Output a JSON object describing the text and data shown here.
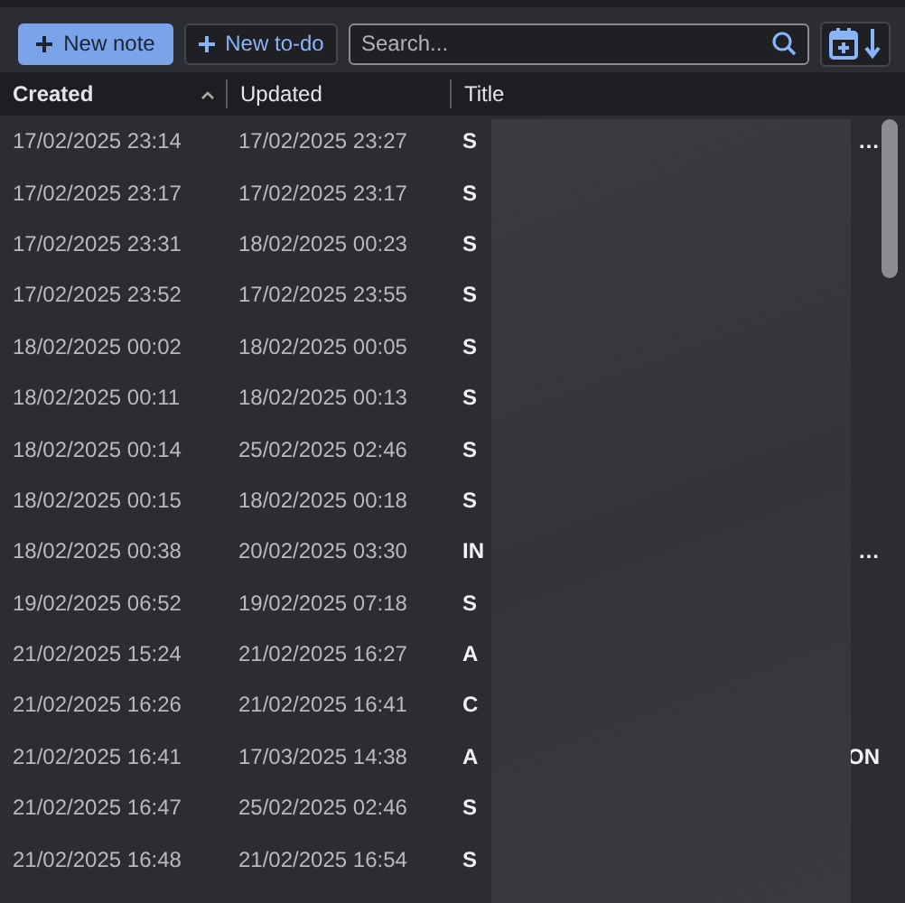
{
  "toolbar": {
    "new_note": "New note",
    "new_todo": "New to-do",
    "search": {
      "placeholder": "Search..."
    }
  },
  "columns": [
    {
      "label": "Created",
      "sorted": true
    },
    {
      "label": "Updated",
      "sorted": false
    },
    {
      "label": "Title",
      "sorted": false
    }
  ],
  "rows": [
    {
      "created": "17/02/2025 23:14",
      "updated": "17/02/2025 23:27",
      "title": "S",
      "title_end": "…"
    },
    {
      "created": "17/02/2025 23:17",
      "updated": "17/02/2025 23:17",
      "title": "S"
    },
    {
      "created": "17/02/2025 23:31",
      "updated": "18/02/2025 00:23",
      "title": "S"
    },
    {
      "created": "17/02/2025 23:52",
      "updated": "17/02/2025 23:55",
      "title": "S"
    },
    {
      "created": "18/02/2025 00:02",
      "updated": "18/02/2025 00:05",
      "title": "S"
    },
    {
      "created": "18/02/2025 00:11",
      "updated": "18/02/2025 00:13",
      "title": "S"
    },
    {
      "created": "18/02/2025 00:14",
      "updated": "25/02/2025 02:46",
      "title": "S"
    },
    {
      "created": "18/02/2025 00:15",
      "updated": "18/02/2025 00:18",
      "title": "S"
    },
    {
      "created": "18/02/2025 00:38",
      "updated": "20/02/2025 03:30",
      "title": "IN",
      "title_end": "…"
    },
    {
      "created": "19/02/2025 06:52",
      "updated": "19/02/2025 07:18",
      "title": "S"
    },
    {
      "created": "21/02/2025 15:24",
      "updated": "21/02/2025 16:27",
      "title": "A"
    },
    {
      "created": "21/02/2025 16:26",
      "updated": "21/02/2025 16:41",
      "title": "C"
    },
    {
      "created": "21/02/2025 16:41",
      "updated": "17/03/2025 14:38",
      "title": "A",
      "title_end": "ON"
    },
    {
      "created": "21/02/2025 16:47",
      "updated": "25/02/2025 02:46",
      "title": "S"
    },
    {
      "created": "21/02/2025 16:48",
      "updated": "21/02/2025 16:54",
      "title": "S"
    }
  ]
}
